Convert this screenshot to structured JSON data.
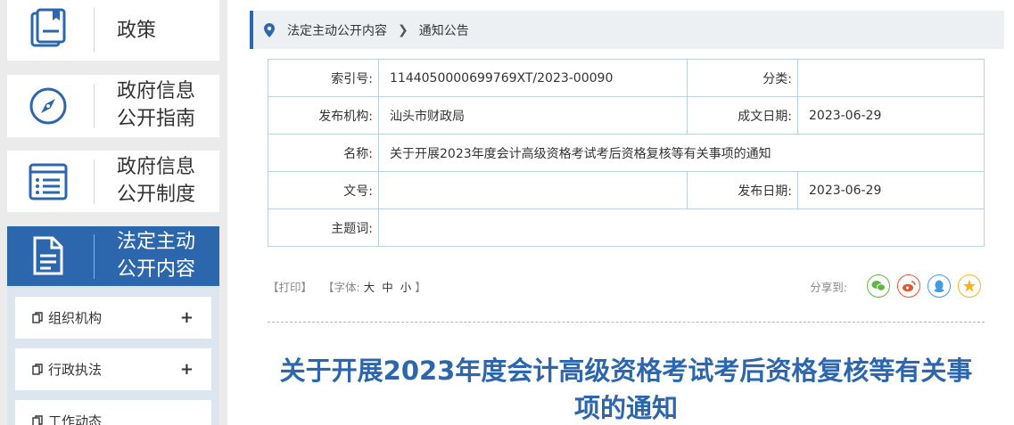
{
  "sidebar": {
    "nav": [
      {
        "label": "政策"
      },
      {
        "label": "政府信息\n公开指南"
      },
      {
        "label": "政府信息\n公开制度"
      },
      {
        "label": "法定主动\n公开内容"
      }
    ],
    "sub_items": [
      {
        "label": "组织机构"
      },
      {
        "label": "行政执法"
      },
      {
        "label": "工作动态"
      }
    ]
  },
  "breadcrumb": {
    "level1": "法定主动公开内容",
    "level2": "通知公告"
  },
  "meta": {
    "index_label": "索引号:",
    "index_value": "1144050000699769XT/2023-00090",
    "category_label": "分类:",
    "category_value": "",
    "publisher_label": "发布机构:",
    "publisher_value": "汕头市财政局",
    "created_label": "成文日期:",
    "created_value": "2023-06-29",
    "name_label": "名称:",
    "name_value": "关于开展2023年度会计高级资格考试考后资格复核等有关事项的通知",
    "docno_label": "文号:",
    "docno_value": "",
    "published_label": "发布日期:",
    "published_value": "2023-06-29",
    "keywords_label": "主题词:",
    "keywords_value": ""
  },
  "toolbar": {
    "print": "【打印】",
    "font_prefix": "【字体:",
    "font_large": "大",
    "font_medium": "中",
    "font_small": "小",
    "font_suffix": "】",
    "share_label": "分享到:"
  },
  "article": {
    "title": "关于开展2023年度会计高级资格考试考后资格复核等有关事项的通知"
  },
  "colors": {
    "accent": "#2c66ad",
    "wechat": "#5fb646",
    "weibo": "#e7542e",
    "qq": "#3f9be6",
    "qzone": "#f5b520"
  }
}
